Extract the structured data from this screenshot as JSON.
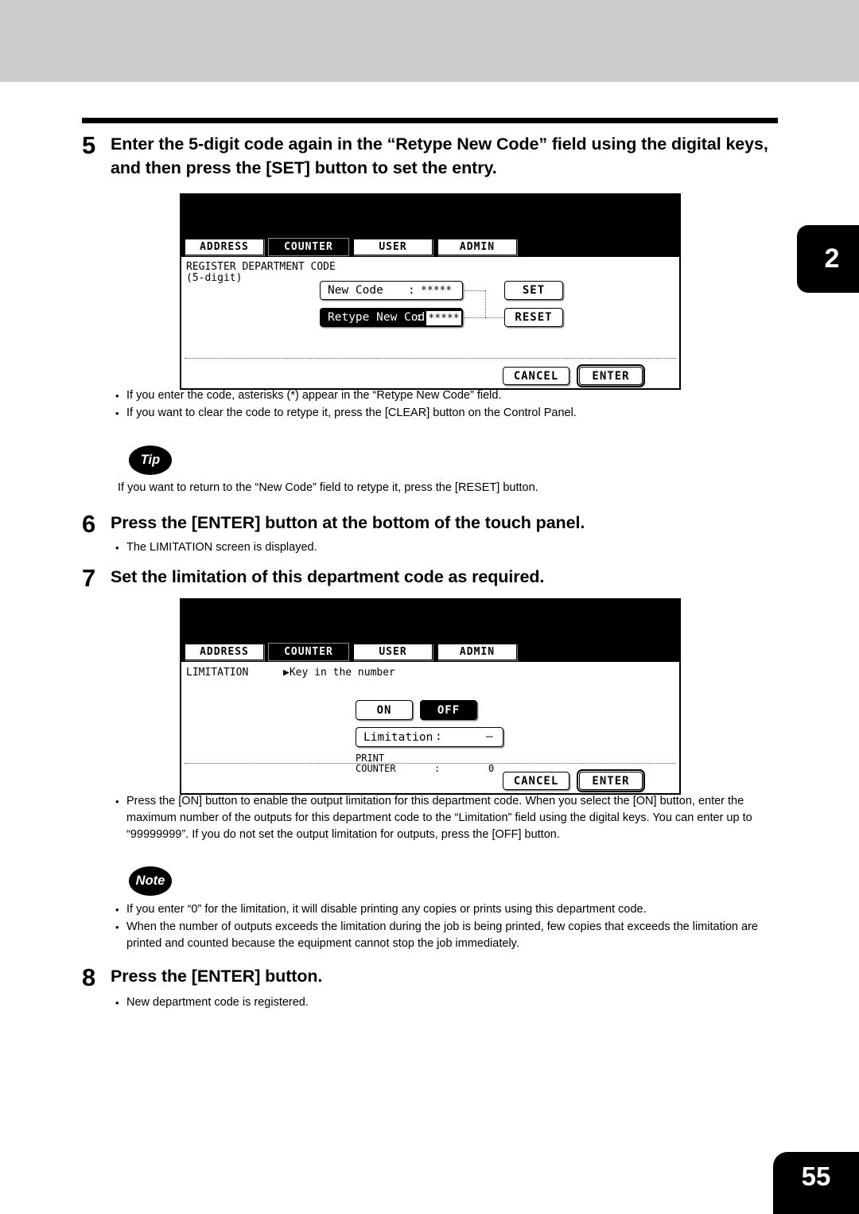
{
  "page": {
    "side_tab_number": "2",
    "page_number": "55"
  },
  "steps": [
    {
      "number": "5",
      "title": "Enter the 5-digit code again in the “Retype New Code” field using the digital keys, and then press the [SET] button to set the entry.",
      "bullets": [
        "If you enter the code, asterisks (*) appear in the “Retype New Code” field.",
        "If you want to clear the code to retype it, press the [CLEAR] button on the Control Panel."
      ]
    },
    {
      "number": "6",
      "title": "Press the [ENTER] button at the bottom of the touch panel.",
      "bullets": [
        "The LIMITATION screen is displayed."
      ]
    },
    {
      "number": "7",
      "title": "Set the limitation of this department code as required.",
      "bullets": [
        "Press the [ON] button to enable the output limitation for this department code. When you select the [ON] button, enter the maximum number of the outputs for this department code to the “Limitation” field using the digital keys. You can enter up to “99999999”. If you do not set the output limitation for outputs, press the [OFF] button."
      ]
    },
    {
      "number": "8",
      "title": "Press the [ENTER] button.",
      "bullets": [
        "New department code is registered."
      ]
    }
  ],
  "tip": {
    "badge": "Tip",
    "text": "If you want to return to the “New Code” field to retype it, press the [RESET] button."
  },
  "note": {
    "badge": "Note",
    "bullets": [
      "If you enter “0” for the limitation, it will disable printing any copies or prints using this department code.",
      "When the number of outputs exceeds the limitation during the job is being printed, few copies that exceeds the limitation are printed and counted because the equipment cannot stop the job immediately."
    ]
  },
  "panel_register": {
    "tabs": [
      {
        "label": "ADDRESS",
        "selected": false
      },
      {
        "label": "COUNTER",
        "selected": true
      },
      {
        "label": "USER",
        "selected": false
      },
      {
        "label": "ADMIN",
        "selected": false
      }
    ],
    "title_line1": "REGISTER DEPARTMENT CODE",
    "title_line2": "(5-digit)",
    "fields": [
      {
        "label": "New Code",
        "colon": ":",
        "value": "*****",
        "selected": false
      },
      {
        "label": "Retype New Code",
        "colon": ":",
        "value": "*****",
        "selected": true
      }
    ],
    "side_buttons": [
      {
        "label": "SET"
      },
      {
        "label": "RESET"
      }
    ],
    "footer_buttons": [
      {
        "label": "CANCEL",
        "emphasized": false
      },
      {
        "label": "ENTER",
        "emphasized": true
      }
    ]
  },
  "panel_limitation": {
    "tabs": [
      {
        "label": "ADDRESS",
        "selected": false
      },
      {
        "label": "COUNTER",
        "selected": true
      },
      {
        "label": "USER",
        "selected": false
      },
      {
        "label": "ADMIN",
        "selected": false
      }
    ],
    "title": "LIMITATION",
    "hint": "▶Key in the number",
    "toggle": [
      {
        "label": "ON",
        "selected": false
      },
      {
        "label": "OFF",
        "selected": true
      }
    ],
    "limitation_field": {
      "label": "Limitation",
      "colon": ":",
      "value": "–"
    },
    "print_counter": {
      "label_line1": "PRINT",
      "label_line2": "COUNTER",
      "colon": ":",
      "value": "0"
    },
    "footer_buttons": [
      {
        "label": "CANCEL",
        "emphasized": false
      },
      {
        "label": "ENTER",
        "emphasized": true
      }
    ]
  }
}
